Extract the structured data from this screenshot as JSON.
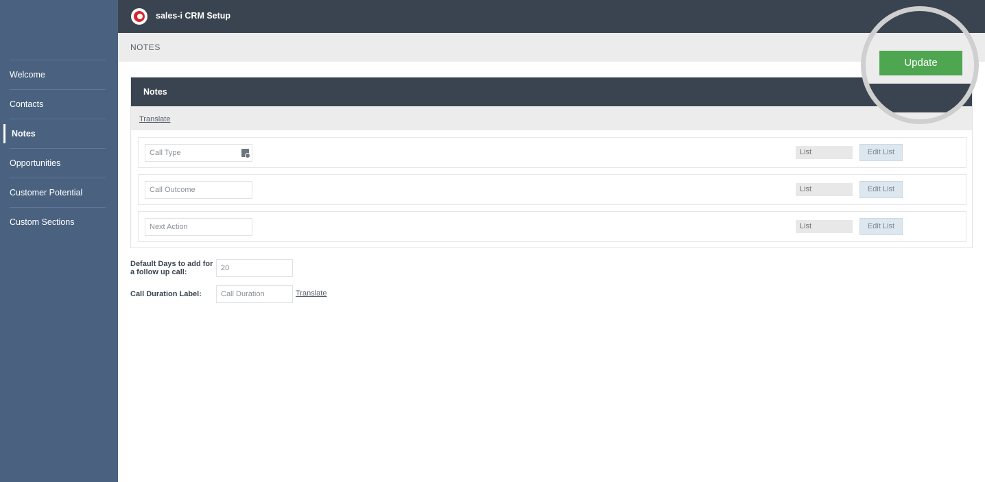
{
  "app": {
    "title": "sales-i CRM Setup"
  },
  "breadcrumb": "NOTES",
  "sidebar": {
    "items": [
      {
        "label": "Welcome"
      },
      {
        "label": "Contacts"
      },
      {
        "label": "Notes",
        "active": true
      },
      {
        "label": "Opportunities"
      },
      {
        "label": "Customer Potential"
      },
      {
        "label": "Custom Sections"
      }
    ]
  },
  "actions": {
    "update_label": "Update"
  },
  "panel": {
    "title": "Notes",
    "translate_link": "Translate",
    "fields": [
      {
        "value": "Call Type",
        "type": "List",
        "edit_label": "Edit List",
        "icon": "translate-icon"
      },
      {
        "value": "Call Outcome",
        "type": "List",
        "edit_label": "Edit List"
      },
      {
        "value": "Next Action",
        "type": "List",
        "edit_label": "Edit List"
      }
    ]
  },
  "settings": {
    "default_days_label": "Default Days to add for a follow up call:",
    "default_days_value": "20",
    "duration_label": "Call Duration Label:",
    "duration_value": "Call Duration",
    "duration_translate": "Translate"
  },
  "colors": {
    "sidebar": "#4a6280",
    "header": "#3a4450",
    "accent": "#4fa651",
    "brand": "#d7262e"
  }
}
